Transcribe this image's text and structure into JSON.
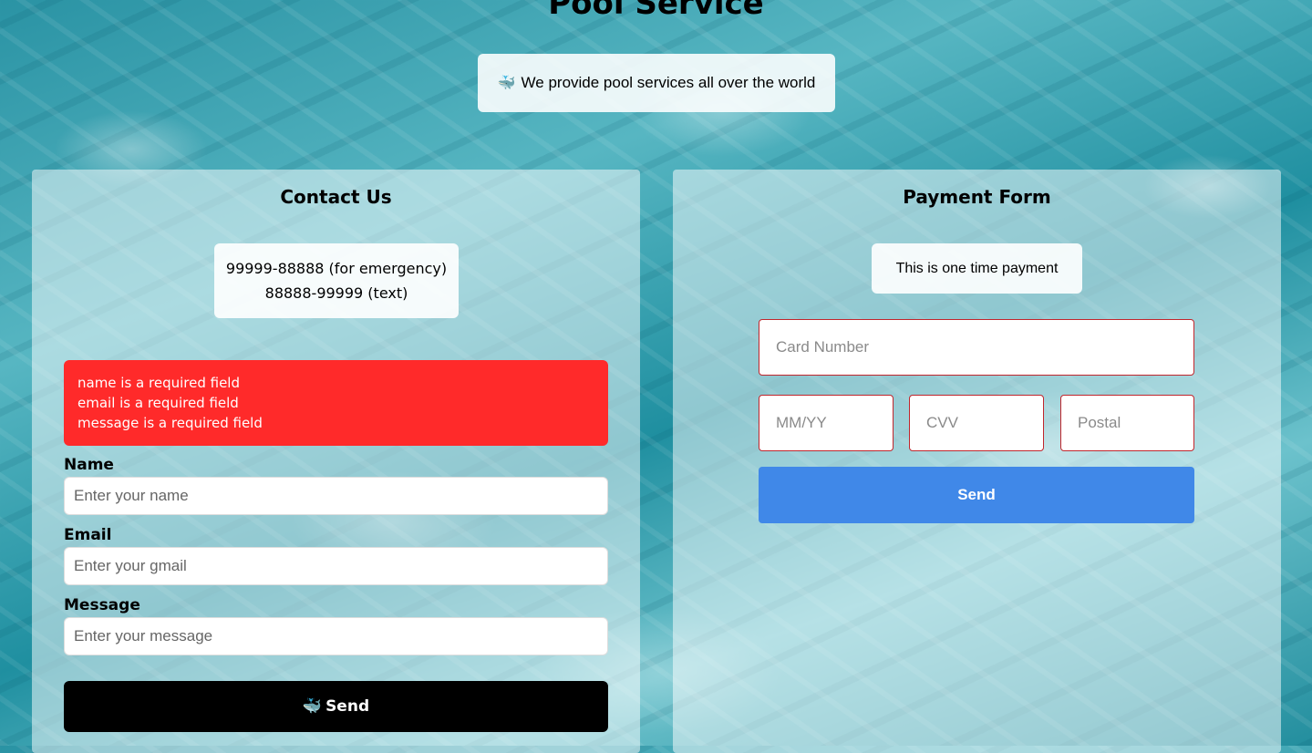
{
  "page": {
    "title": "Pool Service",
    "tagline": {
      "icon": "whale-icon",
      "emoji": "🐳",
      "text": "We provide pool services all over the world"
    }
  },
  "contact": {
    "title": "Contact Us",
    "phones": [
      "99999-88888 (for emergency)",
      "88888-99999 (text)"
    ],
    "errors": [
      "name is a required field",
      "email is a required field",
      "message is a required field"
    ],
    "error_color": "#ff2a2a",
    "fields": {
      "name": {
        "label": "Name",
        "placeholder": "Enter your name",
        "value": ""
      },
      "email": {
        "label": "Email",
        "placeholder": "Enter your gmail",
        "value": ""
      },
      "message": {
        "label": "Message",
        "placeholder": "Enter your message",
        "value": ""
      }
    },
    "send": {
      "icon": "whale-icon",
      "emoji": "🐳",
      "label": "Send"
    }
  },
  "payment": {
    "title": "Payment Form",
    "note": "This is one time payment",
    "fields": {
      "card_number": {
        "placeholder": "Card Number",
        "value": ""
      },
      "expiry": {
        "placeholder": "MM/YY",
        "value": ""
      },
      "cvv": {
        "placeholder": "CVV",
        "value": ""
      },
      "postal": {
        "placeholder": "Postal",
        "value": ""
      }
    },
    "send": {
      "label": "Send"
    },
    "accent": "#4088e8",
    "input_border": "#c0262d"
  }
}
